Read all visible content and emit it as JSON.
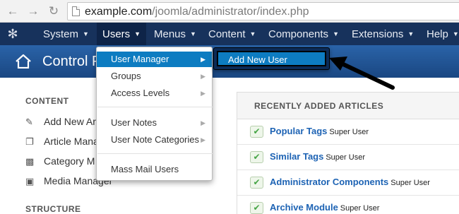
{
  "browser": {
    "url_domain": "example.com",
    "url_path": "/joomla/administrator/index.php"
  },
  "navbar": {
    "items": [
      {
        "label": "System"
      },
      {
        "label": "Users"
      },
      {
        "label": "Menus"
      },
      {
        "label": "Content"
      },
      {
        "label": "Components"
      },
      {
        "label": "Extensions"
      },
      {
        "label": "Help"
      }
    ]
  },
  "header": {
    "title": "Control P"
  },
  "sidebar": {
    "content_heading": "CONTENT",
    "items": [
      {
        "label": "Add New Ar",
        "icon": "pencil-icon"
      },
      {
        "label": "Article Mana",
        "icon": "copy-icon"
      },
      {
        "label": "Category M",
        "icon": "folder-icon"
      },
      {
        "label": "Media Manager",
        "icon": "image-icon"
      }
    ],
    "structure_heading": "STRUCTURE"
  },
  "articles": {
    "title": "RECENTLY ADDED ARTICLES",
    "rows": [
      {
        "title": "Popular Tags",
        "author": "Super User"
      },
      {
        "title": "Similar Tags",
        "author": "Super User"
      },
      {
        "title": "Administrator Components",
        "author": "Super User"
      },
      {
        "title": "Archive Module",
        "author": "Super User"
      }
    ]
  },
  "users_menu": {
    "items": [
      {
        "label": "User Manager",
        "has_submenu": true
      },
      {
        "label": "Groups",
        "has_submenu": true
      },
      {
        "label": "Access Levels",
        "has_submenu": true
      },
      {
        "label": "User Notes",
        "has_submenu": true
      },
      {
        "label": "User Note Categories",
        "has_submenu": true
      },
      {
        "label": "Mass Mail Users",
        "has_submenu": false
      }
    ],
    "submenu_item": "Add New User"
  },
  "colors": {
    "navbar": "#17325c",
    "header": "#1f4e8c",
    "highlight": "#0d7cc1",
    "link": "#1d63b4",
    "check": "#46a546"
  }
}
